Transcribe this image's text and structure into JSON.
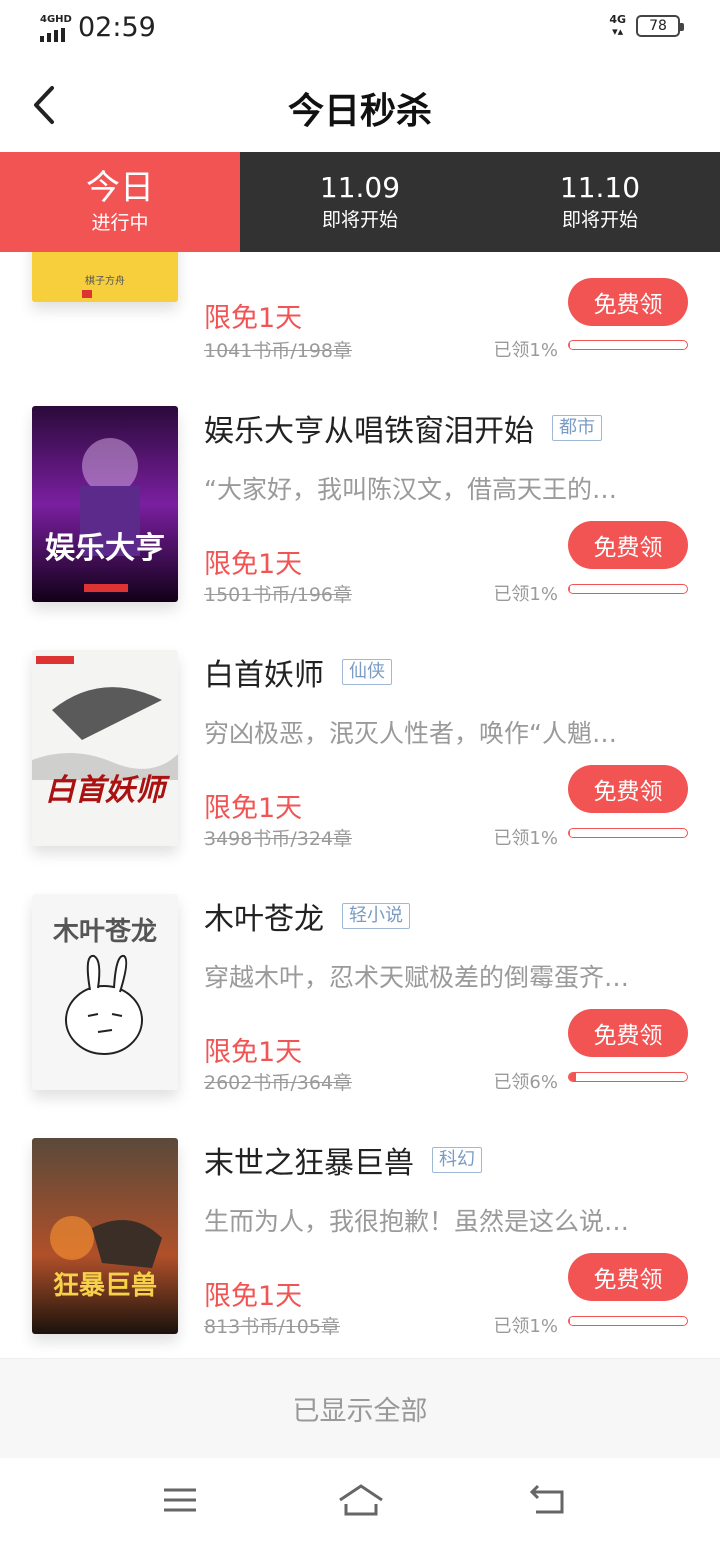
{
  "status_bar": {
    "network": "4GHD",
    "time": "02:59",
    "network_right": "4G",
    "battery": "78"
  },
  "header": {
    "title": "今日秒杀"
  },
  "tabs": [
    {
      "date": "今日",
      "status": "进行中",
      "active": true
    },
    {
      "date": "11.09",
      "status": "即将开始",
      "active": false
    },
    {
      "date": "11.10",
      "status": "即将开始",
      "active": false
    }
  ],
  "books": [
    {
      "title": "",
      "tag": "",
      "desc": "",
      "free_label": "限免1天",
      "original": "1041书币/198章",
      "claim_label": "免费领",
      "claimed": "已领1%",
      "claimed_fraction": 0.01,
      "cover_text": "棋子方舟"
    },
    {
      "title": "娱乐大亨从唱铁窗泪开始",
      "tag": "都市",
      "desc": "“大家好，我叫陈汉文，借高天王的…",
      "free_label": "限免1天",
      "original": "1501书币/196章",
      "claim_label": "免费领",
      "claimed": "已领1%",
      "claimed_fraction": 0.01,
      "cover_text": "娱乐大亨"
    },
    {
      "title": "白首妖师",
      "tag": "仙侠",
      "desc": "穷凶极恶，泯灭人性者，唤作“人魈…",
      "free_label": "限免1天",
      "original": "3498书币/324章",
      "claim_label": "免费领",
      "claimed": "已领1%",
      "claimed_fraction": 0.01,
      "cover_text": "白首妖师"
    },
    {
      "title": "木叶苍龙",
      "tag": "轻小说",
      "desc": "穿越木叶，忍术天赋极差的倒霉蛋齐…",
      "free_label": "限免1天",
      "original": "2602书币/364章",
      "claim_label": "免费领",
      "claimed": "已领6%",
      "claimed_fraction": 0.06,
      "cover_text": "木叶苍龙"
    },
    {
      "title": "末世之狂暴巨兽",
      "tag": "科幻",
      "desc": "生而为人，我很抱歉！虽然是这么说…",
      "free_label": "限免1天",
      "original": "813书币/105章",
      "claim_label": "免费领",
      "claimed": "已领1%",
      "claimed_fraction": 0.01,
      "cover_text": "狂暴巨兽"
    }
  ],
  "footer": {
    "text": "已显示全部"
  },
  "colors": {
    "accent": "#f25454",
    "tab_bg": "#323232",
    "tag": "#7a9cc4",
    "muted": "#9a9a9a"
  }
}
